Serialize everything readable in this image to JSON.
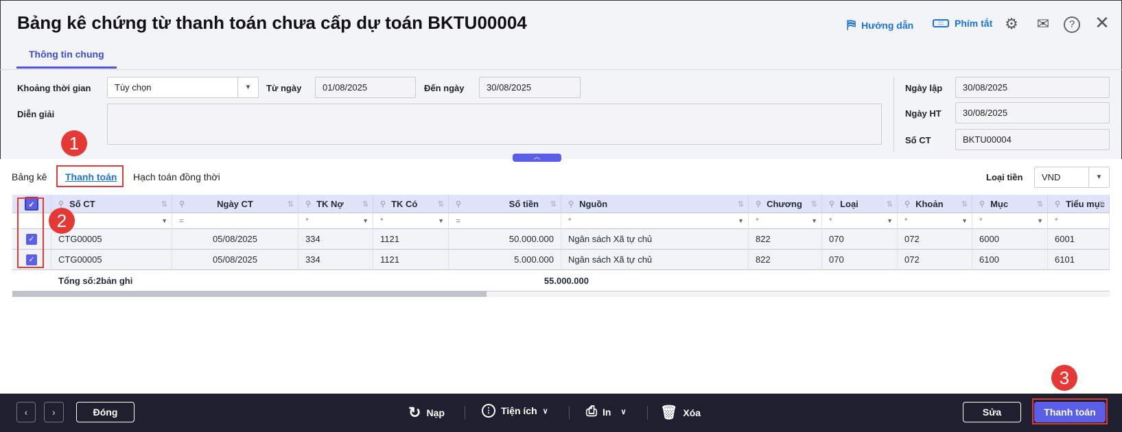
{
  "header": {
    "title": "Bảng kê chứng từ thanh toán chưa cấp dự toán BKTU00004",
    "guide": "Hướng dẫn",
    "shortcuts": "Phím tắt",
    "icons": [
      "settings-icon",
      "mail-forward-icon",
      "help-icon",
      "close-icon"
    ]
  },
  "tabs": {
    "general": "Thông tin chung"
  },
  "form": {
    "period_label": "Khoảng thời gian",
    "period_value": "Tùy chọn",
    "from_label": "Từ ngày",
    "from_value": "01/08/2025",
    "to_label": "Đến ngày",
    "to_value": "30/08/2025",
    "desc_label": "Diễn giải",
    "desc_value": "",
    "created_label": "Ngày lập",
    "created_value": "30/08/2025",
    "posted_label": "Ngày HT",
    "posted_value": "30/08/2025",
    "no_label": "Số CT",
    "no_value": "BKTU00004"
  },
  "subtabs": {
    "list": "Bảng kê",
    "payment": "Thanh toán",
    "accounting": "Hạch toán đồng thời",
    "currency_label": "Loại tiền",
    "currency_value": "VND"
  },
  "grid": {
    "columns": [
      "Số CT",
      "Ngày CT",
      "TK Nợ",
      "TK Có",
      "Số tiền",
      "Nguồn",
      "Chương",
      "Loại",
      "Khoản",
      "Mục",
      "Tiểu mục"
    ],
    "filters": [
      "",
      "=",
      "*",
      "*",
      "=",
      "*",
      "*",
      "*",
      "*",
      "*",
      "*"
    ],
    "rows": [
      [
        "CTG00005",
        "05/08/2025",
        "334",
        "1121",
        "50.000.000",
        "Ngân sách Xã tự chủ",
        "822",
        "070",
        "072",
        "6000",
        "6001"
      ],
      [
        "CTG00005",
        "05/08/2025",
        "334",
        "1121",
        "5.000.000",
        "Ngân sách Xã tự chủ",
        "822",
        "070",
        "072",
        "6100",
        "6101"
      ]
    ],
    "total_prefix": "Tổng số: ",
    "total_count": "2",
    "total_suffix": " bản ghi",
    "total_amount": "55.000.000"
  },
  "footer": {
    "close": "Đóng",
    "reload": "Nạp",
    "utilities": "Tiện ích",
    "print": "In",
    "delete": "Xóa",
    "edit": "Sửa",
    "pay": "Thanh toán"
  },
  "annotations": [
    "1",
    "2",
    "3"
  ],
  "colors": {
    "accent": "#5b5fe8",
    "link": "#1a73d9",
    "annotation": "#e53935",
    "footer": "#1e2030"
  }
}
